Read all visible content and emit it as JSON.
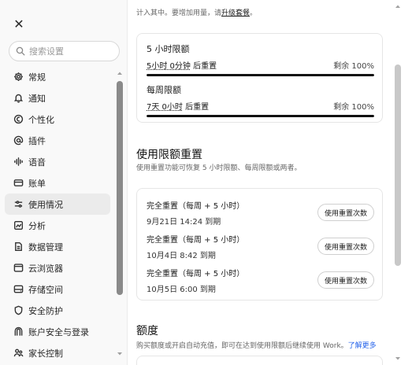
{
  "sidebar": {
    "close_glyph": "✕",
    "search_placeholder": "搜索设置",
    "items": [
      {
        "label": "常规",
        "icon": "gear-icon"
      },
      {
        "label": "通知",
        "icon": "bell-icon"
      },
      {
        "label": "个性化",
        "icon": "personalize-icon"
      },
      {
        "label": "插件",
        "icon": "at-icon"
      },
      {
        "label": "语音",
        "icon": "waveform-icon"
      },
      {
        "label": "账单",
        "icon": "card-icon"
      },
      {
        "label": "使用情况",
        "icon": "usage-icon",
        "active": true
      },
      {
        "label": "分析",
        "icon": "analytics-icon"
      },
      {
        "label": "数据管理",
        "icon": "data-icon"
      },
      {
        "label": "云浏览器",
        "icon": "browser-icon"
      },
      {
        "label": "存储空间",
        "icon": "storage-icon"
      },
      {
        "label": "安全防护",
        "icon": "shield-icon"
      },
      {
        "label": "账户安全与登录",
        "icon": "account-security-icon"
      },
      {
        "label": "家长控制",
        "icon": "parental-icon"
      }
    ]
  },
  "main": {
    "top_note": {
      "text": "计入其中。要增加用量，请",
      "link": "升级套餐",
      "tail": "。"
    },
    "limits": [
      {
        "title": "5 小时限额",
        "reset": "5小时 0分钟",
        "reset_suffix": "后重置",
        "remaining": "剩余 100%",
        "fraction": 1.0
      },
      {
        "title": "每周限额",
        "reset": "7天 0小时",
        "reset_suffix": "后重置",
        "remaining": "剩余 100%",
        "fraction": 1.0
      }
    ],
    "reset_section": {
      "title": "使用限额重置",
      "desc": "使用重置功能可恢复 5 小时限额、每周限额或两者。",
      "items": [
        {
          "name": "完全重置（每周 + 5 小时）",
          "expiry": "9月21日 14:24 到期",
          "button": "使用重置次数"
        },
        {
          "name": "完全重置（每周 + 5 小时）",
          "expiry": "10月4日 8:42 到期",
          "button": "使用重置次数"
        },
        {
          "name": "完全重置（每周 + 5 小时）",
          "expiry": "10月5日 6:00 到期",
          "button": "使用重置次数"
        }
      ]
    },
    "credit_section": {
      "title": "额度",
      "desc": "购买额度或开启自动充值，即可在达到使用限额后继续使用 Work。",
      "link": "了解更多"
    }
  }
}
